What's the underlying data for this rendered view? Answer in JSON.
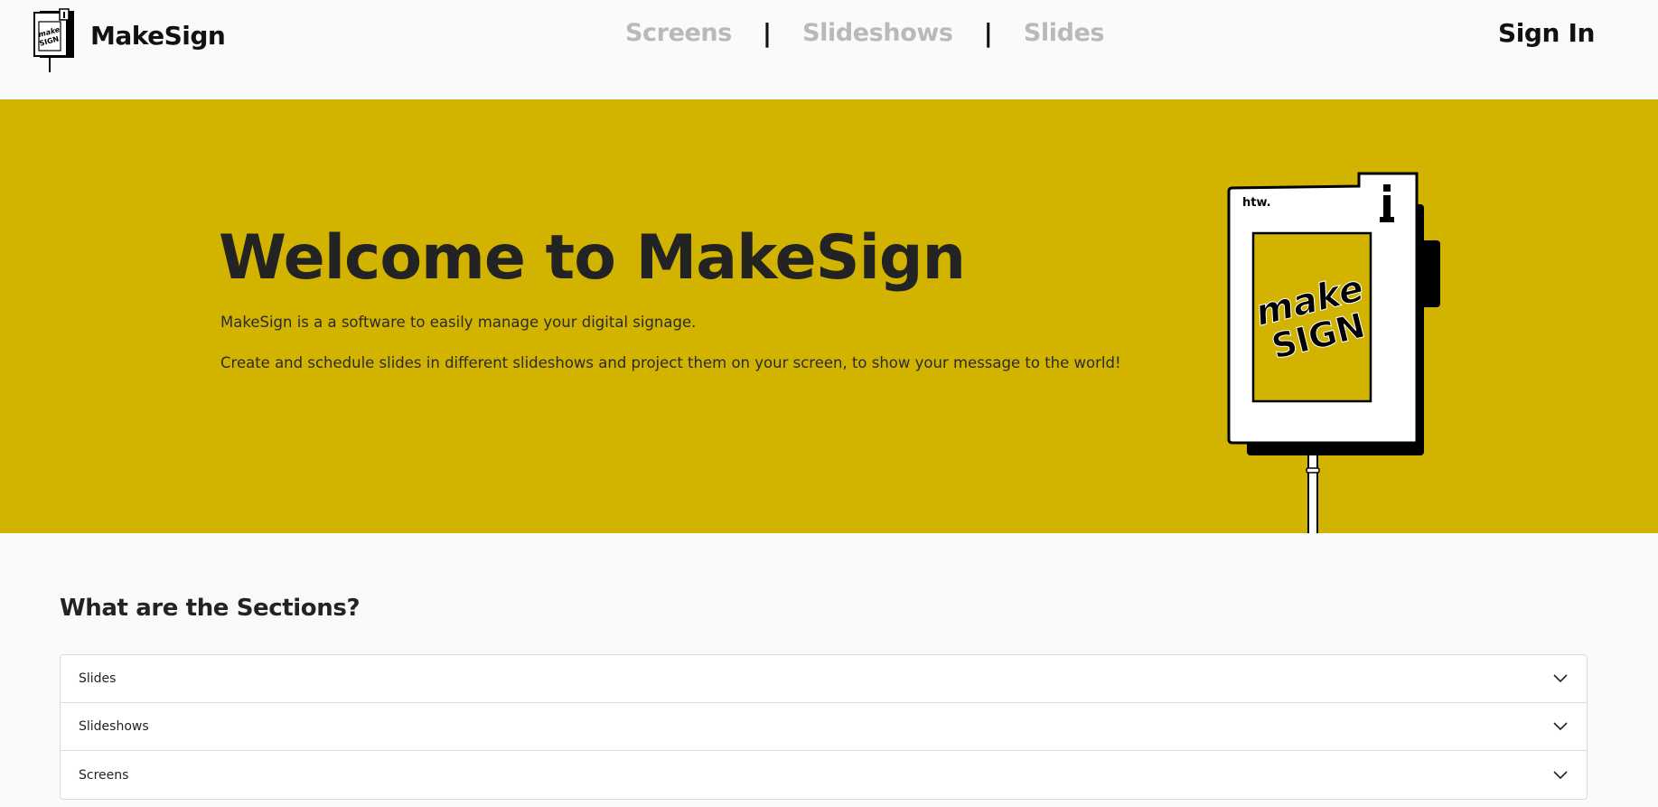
{
  "header": {
    "brand_name": "MakeSign",
    "logo_icon": "makesign-sign-logo",
    "nav": [
      {
        "label": "Screens"
      },
      {
        "label": "Slideshows"
      },
      {
        "label": "Slides"
      }
    ],
    "nav_separator": "|",
    "sign_in_label": "Sign In"
  },
  "hero": {
    "title": "Welcome to MakeSign",
    "line1": "MakeSign is a a software to easily manage your digital signage.",
    "line2": "Create and schedule slides in different slideshows and project them on your screen, to show your message to the world!",
    "background_color": "#d2b400",
    "illustration": {
      "brand_text": "htw.",
      "sign_text_top": "make",
      "sign_text_bottom": "SIGN"
    }
  },
  "sections": {
    "title": "What are the Sections?",
    "items": [
      {
        "label": "Slides",
        "icon": "chevron-down-icon"
      },
      {
        "label": "Slideshows",
        "icon": "chevron-down-icon"
      },
      {
        "label": "Screens",
        "icon": "chevron-down-icon"
      }
    ]
  }
}
